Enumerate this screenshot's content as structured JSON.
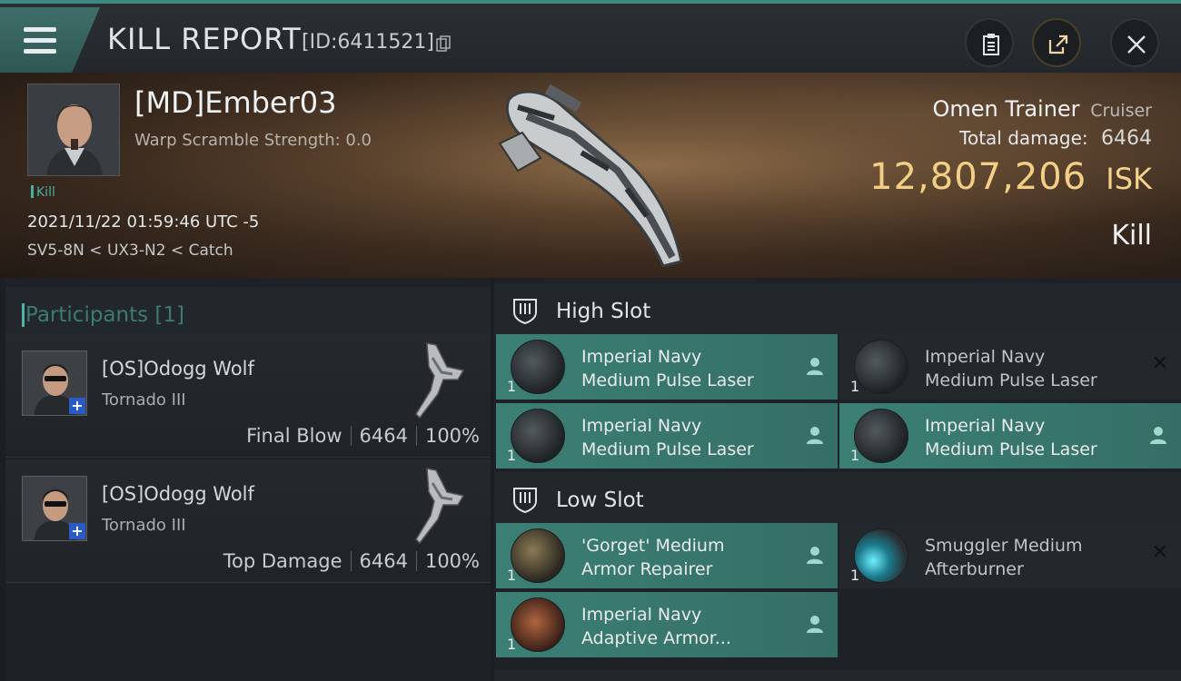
{
  "header": {
    "title": "KILL REPORT",
    "report_id": "[ID:6411521]"
  },
  "victim": {
    "name": "[MD]Ember03",
    "warp_scramble": "Warp Scramble Strength: 0.0",
    "tag": "Kill",
    "time": "2021/11/22 01:59:46 UTC -5",
    "location": "SV5-8N < UX3-N2 < Catch",
    "ship_name": "Omen Trainer",
    "ship_class": "Cruiser",
    "total_damage_label": "Total damage:",
    "total_damage": "6464",
    "isk_value": "12,807,206",
    "isk_unit": "ISK",
    "result": "Kill"
  },
  "participants": {
    "title": "Participants [1]",
    "rows": [
      {
        "name": "[OS]Odogg Wolf",
        "ship": "Tornado III",
        "role": "Final Blow",
        "damage": "6464",
        "percent": "100%"
      },
      {
        "name": "[OS]Odogg Wolf",
        "ship": "Tornado III",
        "role": "Top Damage",
        "damage": "6464",
        "percent": "100%"
      }
    ]
  },
  "fitting": {
    "high_slot": {
      "title": "High Slot",
      "modules": [
        {
          "name": "Imperial Navy\nMedium Pulse Laser",
          "qty": "1",
          "state": "fitted"
        },
        {
          "name": "Imperial Navy\nMedium Pulse Laser",
          "qty": "1",
          "state": "destroyed"
        },
        {
          "name": "Imperial Navy\nMedium Pulse Laser",
          "qty": "1",
          "state": "fitted"
        },
        {
          "name": "Imperial Navy\nMedium Pulse Laser",
          "qty": "1",
          "state": "fitted"
        }
      ]
    },
    "low_slot": {
      "title": "Low Slot",
      "modules": [
        {
          "name": "'Gorget' Medium\nArmor Repairer",
          "qty": "1",
          "state": "fitted"
        },
        {
          "name": "Smuggler Medium\nAfterburner",
          "qty": "1",
          "state": "destroyed"
        },
        {
          "name": "Imperial Navy\nAdaptive Armor...",
          "qty": "1",
          "state": "fitted"
        }
      ]
    }
  },
  "colors": {
    "accent": "#4fb3a6",
    "fitted_bg": "#3b7f75",
    "isk_gold": "#f3cf86"
  },
  "icons": [
    "menu-icon",
    "copy-icon",
    "clipboard-icon",
    "share-icon",
    "close-icon",
    "slot-icon",
    "pilot-icon",
    "x-icon"
  ]
}
